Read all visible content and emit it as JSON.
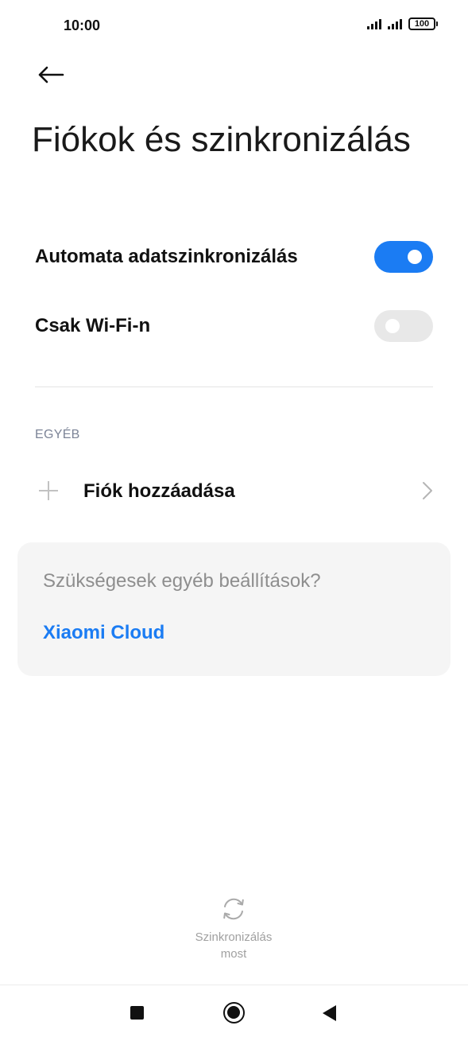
{
  "status_bar": {
    "time": "10:00",
    "battery": "100"
  },
  "header": {
    "back_icon": "arrow-left-icon",
    "title": "Fiókok és szinkronizálás"
  },
  "settings": {
    "auto_sync": {
      "label": "Automata adatszinkronizálás",
      "enabled": true
    },
    "wifi_only": {
      "label": "Csak Wi-Fi-n",
      "enabled": false
    }
  },
  "other_section": {
    "header": "EGYÉB",
    "add_account": {
      "icon": "plus-icon",
      "label": "Fiók hozzáadása",
      "chevron": "chevron-right-icon"
    }
  },
  "card": {
    "question": "Szükségesek egyéb beállítások?",
    "link": "Xiaomi Cloud"
  },
  "sync_now": {
    "icon": "sync-icon",
    "label_line1": "Szinkronizálás",
    "label_line2": "most"
  },
  "navigation": {
    "recents_icon": "square-icon",
    "home_icon": "circle-icon",
    "back_icon": "triangle-back-icon"
  },
  "colors": {
    "accent": "#1b7cf3",
    "toggle_off": "#e8e8e8",
    "section_header": "#7c8497",
    "card_bg": "#f5f5f5"
  }
}
